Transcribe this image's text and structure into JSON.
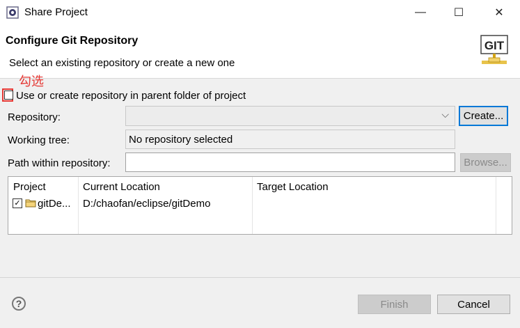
{
  "window": {
    "title": "Share Project",
    "minimize_icon": "minimize-icon",
    "maximize_icon": "maximize-icon",
    "close_icon": "close-icon"
  },
  "header": {
    "title": "Configure Git Repository",
    "description": "Select an existing repository or create a new one",
    "logo_text": "GIT"
  },
  "annotation": {
    "text": "勾选",
    "color": "#e53935"
  },
  "parent_folder": {
    "label": "Use or create repository in parent folder of project",
    "checked": false
  },
  "repository": {
    "label": "Repository:",
    "value": "",
    "create_button": "Create..."
  },
  "working_tree": {
    "label": "Working tree:",
    "value": "No repository selected"
  },
  "path": {
    "label": "Path within repository:",
    "value": "",
    "browse_button": "Browse..."
  },
  "table": {
    "columns": [
      "Project",
      "Current Location",
      "Target Location"
    ],
    "rows": [
      {
        "checked": true,
        "project": "gitDe...",
        "current": "D:/chaofan/eclipse/gitDemo",
        "target": ""
      }
    ]
  },
  "footer": {
    "finish_button": "Finish",
    "cancel_button": "Cancel",
    "help_icon": "help-icon"
  }
}
